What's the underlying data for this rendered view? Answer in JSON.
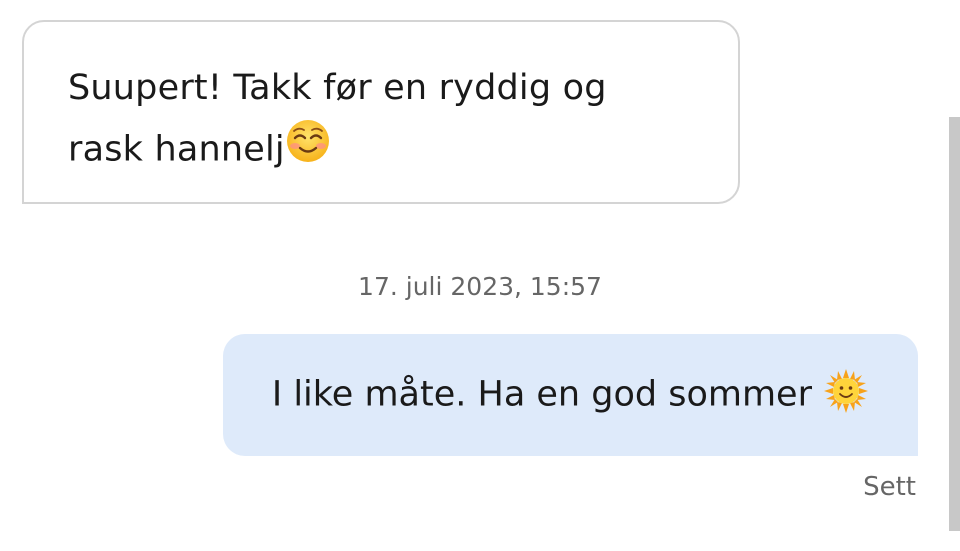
{
  "messages": {
    "incoming": {
      "text_line1": "Suupert! Takk før en ryddig og",
      "text_line2": "rask hannelj",
      "emoji": "smiling-face-with-smiling-eyes-icon"
    },
    "timestamp": "17. juli 2023, 15:57",
    "outgoing": {
      "text": "I like måte. Ha en god sommer",
      "emoji": "sun-with-face-icon",
      "status": "Sett"
    }
  },
  "colors": {
    "outgoing_bubble": "#deeafa",
    "incoming_border": "#d4d4d4",
    "meta_text": "#666666"
  }
}
